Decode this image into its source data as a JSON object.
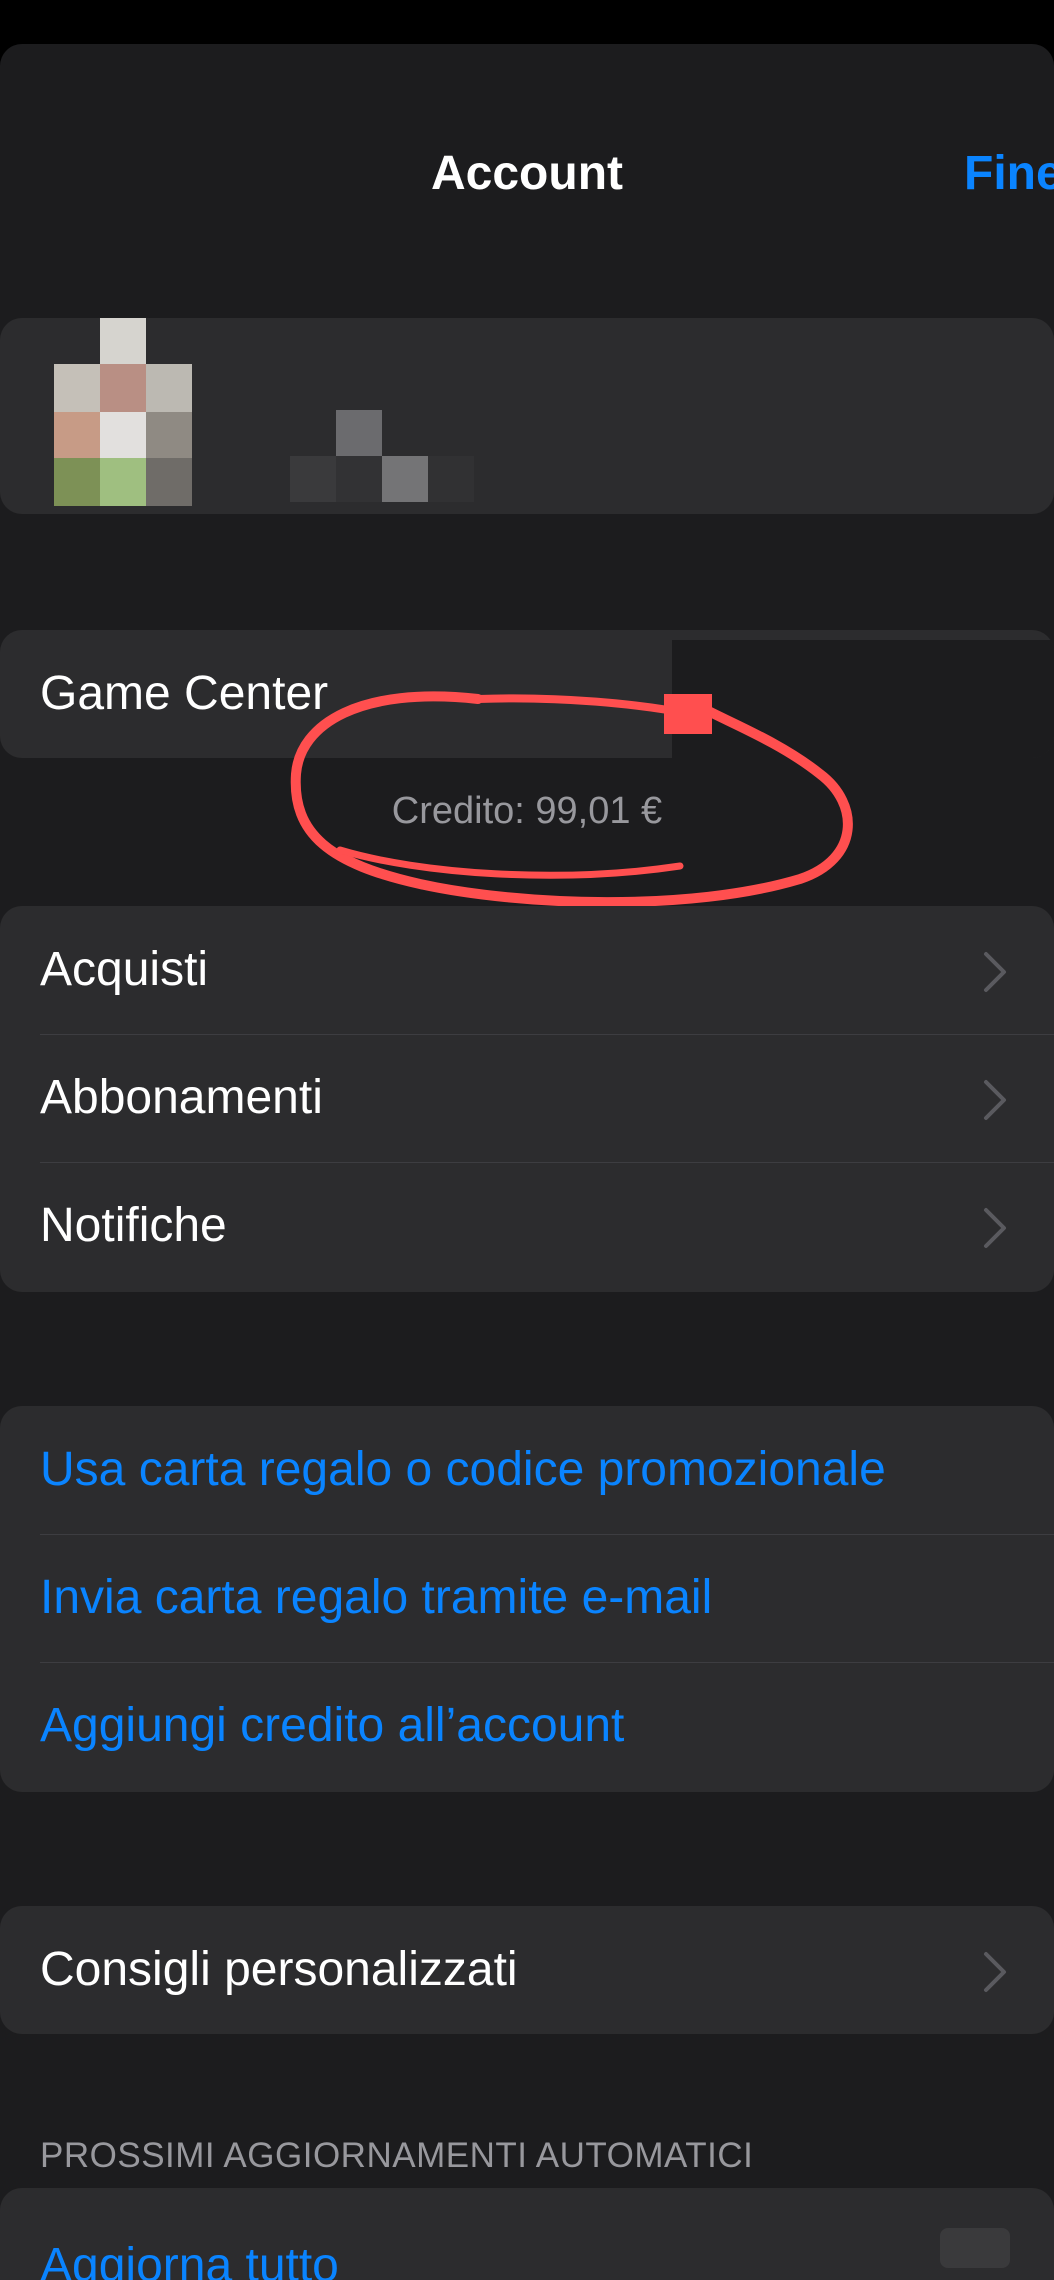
{
  "nav": {
    "title": "Account",
    "done_label": "Fine"
  },
  "game_center": {
    "label": "Game Center"
  },
  "credit": {
    "text": "Credito: 99,01 €"
  },
  "menu": {
    "items": [
      {
        "label": "Acquisti"
      },
      {
        "label": "Abbonamenti"
      },
      {
        "label": "Notifiche"
      }
    ]
  },
  "gift": {
    "items": [
      {
        "label": "Usa carta regalo o codice promozionale"
      },
      {
        "label": "Invia carta regalo tramite e-mail"
      },
      {
        "label": "Aggiungi credito all’account"
      }
    ]
  },
  "recommendations": {
    "label": "Consigli personalizzati"
  },
  "updates": {
    "header": "PROSSIMI AGGIORNAMENTI AUTOMATICI",
    "update_all_label": "Aggiorna tutto"
  },
  "colors": {
    "background": "#1c1c1e",
    "card": "#2c2c2e",
    "accent": "#0a84ff",
    "annotation": "#ff4f4f"
  },
  "icons": [
    "chevron-right-icon"
  ]
}
